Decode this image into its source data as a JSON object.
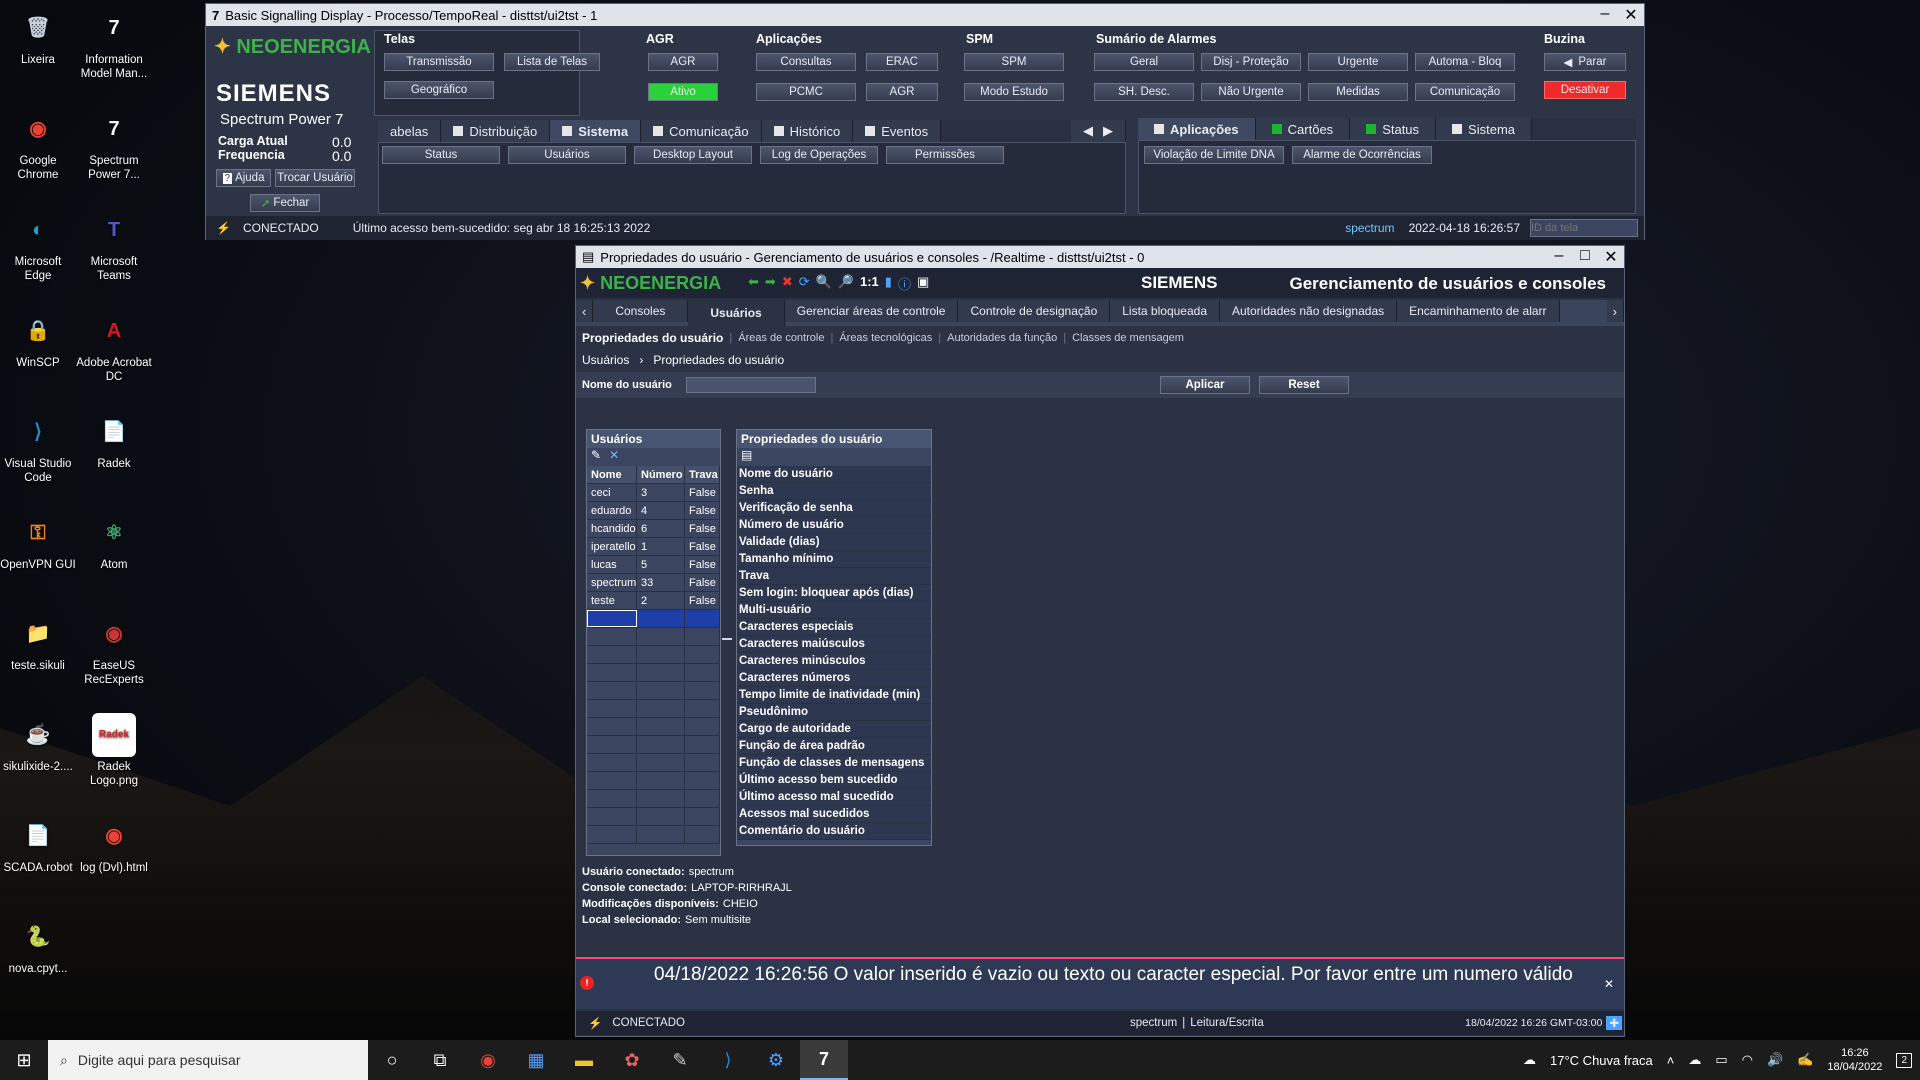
{
  "desktop": {
    "icons": [
      {
        "label": "Lixeira",
        "glyph": "🗑",
        "color": "#c9d3e0"
      },
      {
        "label": "Information Model Man...",
        "glyph": "7",
        "color": "#f3f3f3"
      },
      {
        "label": "Google Chrome",
        "glyph": "◉",
        "color": "#e84335"
      },
      {
        "label": "Spectrum Power 7...",
        "glyph": "7",
        "color": "#f3f3f3"
      },
      {
        "label": "Microsoft Edge",
        "glyph": "◐",
        "color": "#1da1c8"
      },
      {
        "label": "Microsoft Teams",
        "glyph": "T",
        "color": "#5059c9"
      },
      {
        "label": "WinSCP",
        "glyph": "🔒",
        "color": "#4a7fc1"
      },
      {
        "label": "Adobe Acrobat DC",
        "glyph": "A",
        "color": "#d7181f"
      },
      {
        "label": "Visual Studio Code",
        "glyph": "⟩",
        "color": "#1f8ad2"
      },
      {
        "label": "Radek",
        "glyph": "📄",
        "color": "#e8d7a0"
      },
      {
        "label": "OpenVPN GUI",
        "glyph": "⚿",
        "color": "#ea7e20"
      },
      {
        "label": "Atom",
        "glyph": "⚛",
        "color": "#40a977"
      },
      {
        "label": "teste.sikuli",
        "glyph": "📁",
        "color": "#c7c6a6"
      },
      {
        "label": "EaseUS RecExperts",
        "glyph": "◉",
        "color": "#c63636"
      },
      {
        "label": "sikulixide-2....",
        "glyph": "☕",
        "color": "#f1f1f1"
      },
      {
        "label": "Radek Logo.png",
        "glyph": "Radek",
        "color": "#d12a2a"
      },
      {
        "label": "SCADA.robot",
        "glyph": "📄",
        "color": "#f5f5f5"
      },
      {
        "label": "log (Dvl).html",
        "glyph": "◉",
        "color": "#e84335"
      },
      {
        "label": "nova.cpyt...",
        "glyph": "🐍",
        "color": "#3f7bb9"
      }
    ]
  },
  "top_window": {
    "title": "Basic Signalling Display - Processo/TempoReal - disttst/ui2tst - 1",
    "brand": "NEOENERGIA",
    "siemens": "SIEMENS",
    "product": "Spectrum Power 7",
    "carga_label": "Carga Atual",
    "carga_value": "0.0",
    "freq_label": "Frequencia",
    "freq_value": "0.0",
    "ajuda": "Ajuda",
    "trocar": "Trocar Usuário",
    "fechar": "Fechar",
    "sections": {
      "telas": "Telas",
      "agr": "AGR",
      "aplicacoes": "Aplicações",
      "spm": "SPM",
      "alarmes": "Sumário de Alarmes",
      "buzina": "Buzina"
    },
    "telas_buttons": [
      "Transmissão",
      "Lista de Telas",
      "Geográfico"
    ],
    "agr_buttons": [
      "AGR",
      "Ativo"
    ],
    "aplic_buttons": [
      "Consultas",
      "ERAC",
      "PCMC",
      "AGR"
    ],
    "spm_buttons": [
      "SPM",
      "Modo Estudo"
    ],
    "alarm_buttons": [
      "Geral",
      "Disj - Proteção",
      "Urgente",
      "Automa - Bloq",
      "SH. Desc.",
      "Não Urgente",
      "Medidas",
      "Comunicação"
    ],
    "buzina_buttons": [
      "Parar",
      "Desativar"
    ],
    "tabs_left": [
      "abelas",
      "Distribuição",
      "Sistema",
      "Comunicação",
      "Histórico",
      "Eventos"
    ],
    "sub_buttons": [
      "Status",
      "Usuários",
      "Desktop Layout",
      "Log de Operações",
      "Permissões"
    ],
    "tabs_right": [
      "Aplicações",
      "Cartões",
      "Status",
      "Sistema"
    ],
    "right_buttons": [
      "Violação de Limite DNA",
      "Alarme de Ocorrências"
    ],
    "status": {
      "conn": "CONECTADO",
      "last": "Último acesso bem-sucedido: seg abr 18 16:25:13 2022",
      "user": "spectrum",
      "datetime": "2022-04-18 16:26:57",
      "screen_id_placeholder": "ID da tela"
    }
  },
  "user_window": {
    "title": "Propriedades do usuário - Gerenciamento de usuários e consoles - /Realtime - disttst/ui2tst - 0",
    "brand": "NEOENERGIA",
    "siemens": "SIEMENS",
    "header": "Gerenciamento de usuários e consoles",
    "zoom": "1:1",
    "tabs": [
      "Consoles",
      "Usuários",
      "Gerenciar áreas de controle",
      "Controle de designação",
      "Lista bloqueada",
      "Autoridades não designadas",
      "Encaminhamento de alarr"
    ],
    "subtabs": [
      "Propriedades do usuário",
      "Áreas de controle",
      "Áreas tecnológicas",
      "Autoridades da função",
      "Classes de mensagem"
    ],
    "breadcrumb": {
      "a": "Usuários",
      "b": "Propriedades do usuário"
    },
    "filter_label": "Nome do usuário",
    "aplicar": "Aplicar",
    "reset": "Reset",
    "users": {
      "title": "Usuários",
      "cols": [
        "Nome",
        "Número",
        "Trava"
      ],
      "rows": [
        [
          "ceci",
          "3",
          "False"
        ],
        [
          "eduardo",
          "4",
          "False"
        ],
        [
          "hcandido",
          "6",
          "False"
        ],
        [
          "iperatello",
          "1",
          "False"
        ],
        [
          "lucas",
          "5",
          "False"
        ],
        [
          "spectrum",
          "33",
          "False"
        ],
        [
          "teste",
          "2",
          "False"
        ]
      ]
    },
    "props": {
      "title": "Propriedades do usuário",
      "items": [
        "Nome do usuário",
        "Senha",
        "Verificação de senha",
        "Número de usuário",
        "Validade (dias)",
        "Tamanho mínimo",
        "Trava",
        "Sem login: bloquear após (dias)",
        "Multi-usuário",
        "Caracteres especiais",
        "Caracteres maiúsculos",
        "Caracteres minúsculos",
        "Caracteres números",
        "Tempo limite de inatividade (min)",
        "Pseudônimo",
        "Cargo de autoridade",
        "Função de área padrão",
        "Função de classes de mensagens",
        "Último acesso bem sucedido",
        "Último acesso mal sucedido",
        "Acessos mal sucedidos",
        "Comentário do usuário"
      ]
    },
    "info": [
      [
        "Usuário conectado:",
        "spectrum"
      ],
      [
        "Console conectado:",
        "LAPTOP-RIRHRAJL"
      ],
      [
        "Modificações disponíveis:",
        "CHEIO"
      ],
      [
        "Local selecionado:",
        "Sem multisite"
      ]
    ],
    "error": "04/18/2022 16:26:56 O valor inserido é vazio ou texto ou caracter especial. Por favor entre um numero válido",
    "status": {
      "conn": "CONECTADO",
      "user": "spectrum",
      "sep": "|",
      "mode": "Leitura/Escrita",
      "datetime": "18/04/2022 16:26 GMT-03:00"
    }
  },
  "taskbar": {
    "search": "Digite aqui para pesquisar",
    "weather": "17°C  Chuva fraca",
    "time": "16:26",
    "date": "18/04/2022",
    "notif": "2"
  }
}
